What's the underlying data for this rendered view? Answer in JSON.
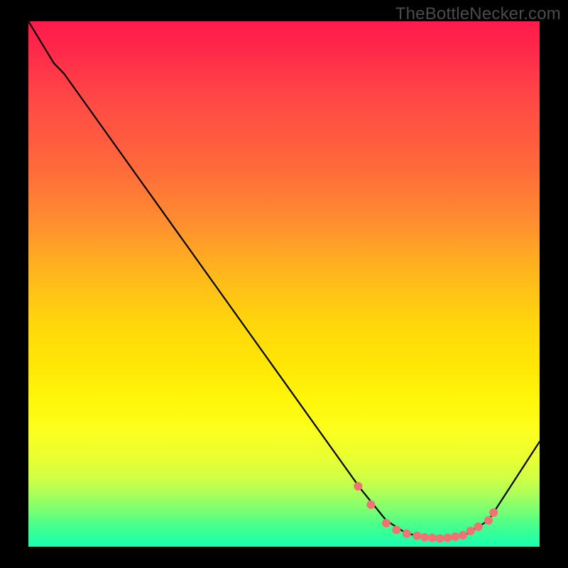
{
  "watermark": "TheBottleNecker.com",
  "chart_data": {
    "type": "line",
    "title": "",
    "xlabel": "",
    "ylabel": "",
    "xlim": [
      0,
      100
    ],
    "ylim": [
      0,
      100
    ],
    "series": [
      {
        "name": "curve",
        "x": [
          0,
          5,
          7,
          65,
          70,
          74,
          80,
          85,
          90,
          100
        ],
        "y": [
          100,
          92,
          90,
          11,
          5,
          2.5,
          1.5,
          2,
          5,
          20
        ]
      }
    ],
    "markers": {
      "name": "flat-region-dots",
      "color": "#f07272",
      "x": [
        64.5,
        67,
        70,
        72,
        74,
        76,
        77.5,
        79,
        80.5,
        82,
        83.5,
        85,
        86.5,
        88,
        90,
        91
      ],
      "y": [
        11.5,
        8,
        4.5,
        3.2,
        2.5,
        2.1,
        1.8,
        1.7,
        1.6,
        1.7,
        1.9,
        2.2,
        3.0,
        3.8,
        5.0,
        6.5
      ]
    }
  }
}
